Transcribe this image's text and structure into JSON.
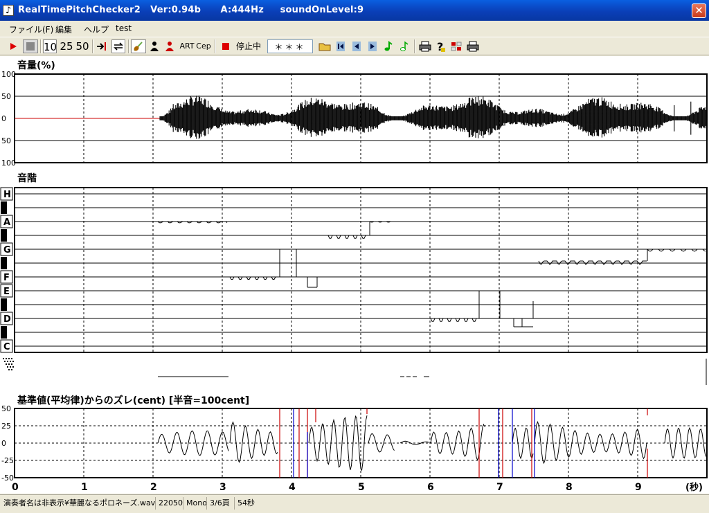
{
  "window": {
    "title": "RealTimePitchChecker2   Ver:0.94b      A:444Hz     soundOnLevel:9",
    "close_glyph": "✕"
  },
  "menu": [
    "ファイル(F)",
    "編集",
    "ヘルプ",
    "test"
  ],
  "toolbar": {
    "zoom_10": "10",
    "zoom_25": "25",
    "zoom_50": "50",
    "art": "ART",
    "cep": "Cep",
    "status": "停止中",
    "note_display": "＊＊＊",
    "icons": [
      "play-icon",
      "stop-icon",
      "jump-end-icon",
      "loop-icon",
      "violin-icon",
      "person-icon",
      "person-red-icon",
      "stop-red-icon",
      "folder-icon",
      "skip-start-icon",
      "prev-icon",
      "next-icon",
      "note-green-icon",
      "note-outline-icon",
      "print-icon",
      "help-icon",
      "split-icon",
      "print2-icon"
    ]
  },
  "volume_panel": {
    "label": "音量(%)",
    "ticks": [
      "100",
      "50",
      "0",
      "50",
      "100"
    ]
  },
  "scale_panel": {
    "label": "音階",
    "notes": [
      "H",
      "A",
      "G",
      "F",
      "E",
      "D",
      "C"
    ]
  },
  "deviation_panel": {
    "label": "基準値(平均律)からのズレ(cent) [半音=100cent]",
    "ticks": [
      "50",
      "25",
      "0",
      "-25",
      "-50"
    ]
  },
  "time_axis": {
    "ticks": [
      "0",
      "1",
      "2",
      "3",
      "4",
      "5",
      "6",
      "7",
      "8",
      "9"
    ],
    "unit": "(秒)"
  },
  "statusbar": {
    "file": "演奏者名は非表示¥華麗なるポロネーズ.wav",
    "rate": "22050",
    "channels": "Mono",
    "page": "3/6頁",
    "duration": "54秒"
  },
  "colors": {
    "title_bg": "#0a4fd0",
    "grid": "#000000",
    "red_trace": "#cc0000",
    "blue_trace": "#0000cc",
    "panel_bg": "#ece9d8"
  }
}
